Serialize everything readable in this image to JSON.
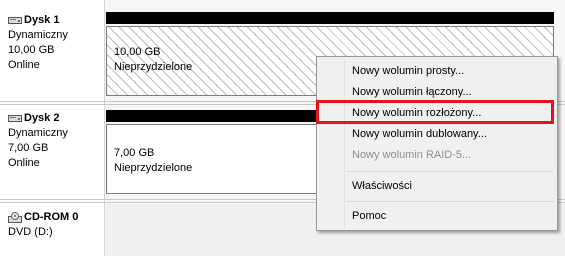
{
  "disks": [
    {
      "name": "Dysk 1",
      "type": "Dynamiczny",
      "size": "10,00 GB",
      "status": "Online",
      "volume": {
        "size": "10,00 GB",
        "state": "Nieprzydzielone"
      }
    },
    {
      "name": "Dysk 2",
      "type": "Dynamiczny",
      "size": "7,00 GB",
      "status": "Online",
      "volume": {
        "size": "7,00 GB",
        "state": "Nieprzydzielone"
      }
    }
  ],
  "cdrom": {
    "name": "CD-ROM 0",
    "type": "DVD (D:)"
  },
  "context_menu": {
    "items": [
      {
        "label": "Nowy wolumin prosty...",
        "enabled": true
      },
      {
        "label": "Nowy wolumin łączony...",
        "enabled": true
      },
      {
        "label": "Nowy wolumin rozłożony...",
        "enabled": true,
        "highlighted": true
      },
      {
        "label": "Nowy wolumin dublowany...",
        "enabled": true
      },
      {
        "label": "Nowy wolumin RAID-5...",
        "enabled": false
      },
      {
        "label": "Właściwości",
        "enabled": true
      },
      {
        "label": "Pomoc",
        "enabled": true
      }
    ]
  },
  "colors": {
    "highlight_border": "#e3141c",
    "disk_bar": "#000000",
    "menu_background": "#f0f0f0",
    "disabled_text": "#8f8f8f"
  },
  "icons": [
    "disk-icon",
    "cdrom-icon"
  ]
}
